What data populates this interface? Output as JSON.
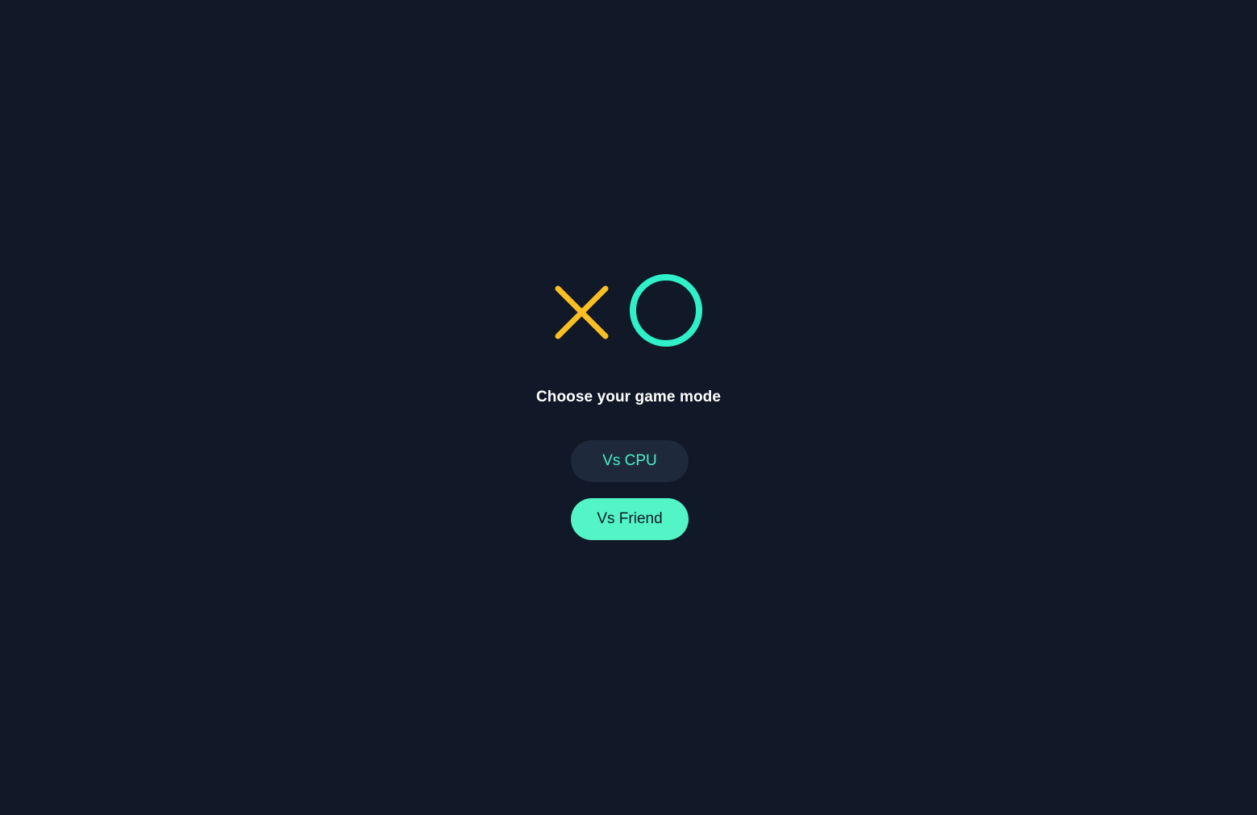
{
  "logo": {
    "x_color": "#fbbf24",
    "o_color": "#2ff0c8",
    "x_icon": "x-mark-icon",
    "o_icon": "o-ring-icon"
  },
  "menu": {
    "prompt": "Choose your game mode",
    "vs_cpu_label": "Vs CPU",
    "vs_friend_label": "Vs Friend"
  },
  "colors": {
    "background": "#111827",
    "cpu_button_bg": "#1e293b",
    "cpu_button_text": "#49f1c5",
    "friend_button_bg": "#53f5c7",
    "friend_button_text": "#111827"
  }
}
